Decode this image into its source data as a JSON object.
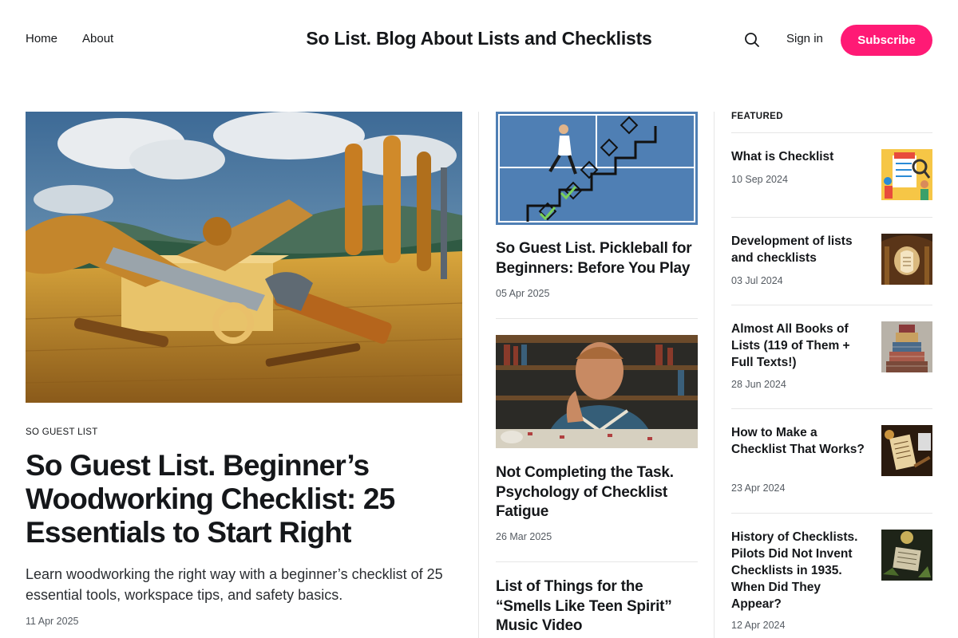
{
  "nav": {
    "home": "Home",
    "about": "About"
  },
  "site_title": "So List. Blog About Lists and Checklists",
  "header_actions": {
    "search_icon": "search-icon",
    "signin": "Sign in",
    "subscribe": "Subscribe"
  },
  "colors": {
    "accent": "#ff1a75",
    "text": "#15171a",
    "muted": "#555b62",
    "divider": "#e6e6e6"
  },
  "main_post": {
    "tag": "SO GUEST LIST",
    "title": "So Guest List. Beginner’s Woodworking Checklist: 25 Essentials to Start Right",
    "excerpt": "Learn woodworking the right way with a beginner’s checklist of 25 essential tools, workspace tips, and safety basics.",
    "date": "11 Apr 2025"
  },
  "middle_posts": [
    {
      "title": "So Guest List. Pickleball for Beginners: Before You Play",
      "date": "05 Apr 2025"
    },
    {
      "title": "Not Completing the Task. Psychology of Checklist Fatigue",
      "date": "26 Mar 2025"
    },
    {
      "title": "List of Things for the “Smells Like Teen Spirit” Music Video",
      "date": ""
    }
  ],
  "featured": {
    "heading": "FEATURED",
    "items": [
      {
        "title": "What is Checklist",
        "date": "10 Sep 2024"
      },
      {
        "title": "Development of lists and checklists",
        "date": "03 Jul 2024"
      },
      {
        "title": "Almost All Books of Lists (119 of Them + Full Texts!)",
        "date": "28 Jun 2024"
      },
      {
        "title": "How to Make a Checklist That Works?",
        "date": "23 Apr 2024"
      },
      {
        "title": "History of Checklists. Pilots Did Not Invent Checklists in 1935. When Did They Appear?",
        "date": "12 Apr 2024"
      }
    ]
  }
}
